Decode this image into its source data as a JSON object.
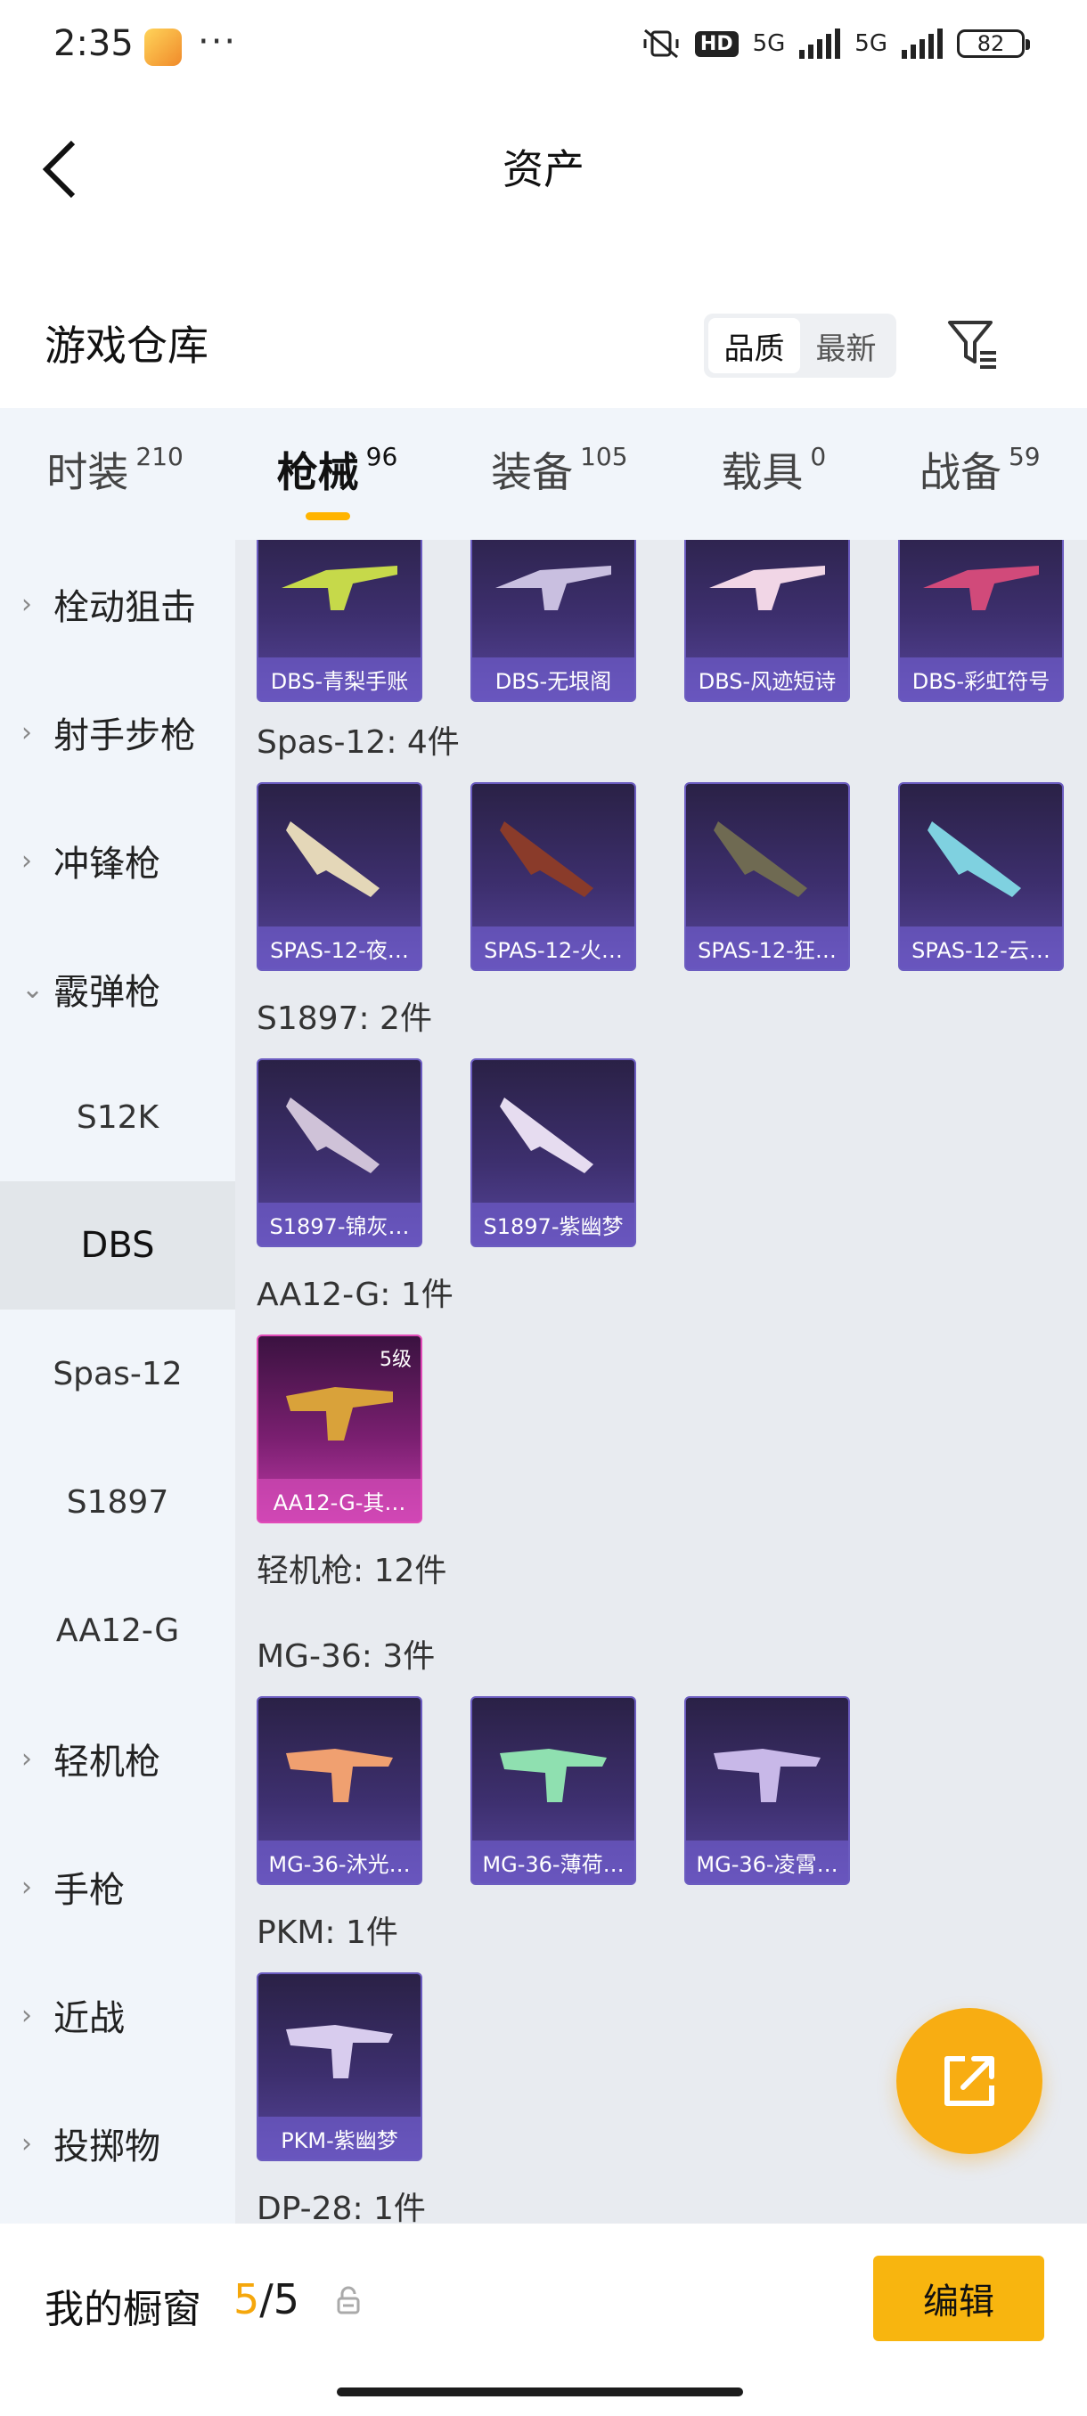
{
  "status": {
    "time": "2:35",
    "more": "···",
    "network": "5G",
    "network2": "5G",
    "hd": "HD",
    "battery": "82"
  },
  "header": {
    "title": "资产"
  },
  "warehouse": {
    "title": "游戏仓库",
    "sort_quality": "品质",
    "sort_newest": "最新"
  },
  "tabs": [
    {
      "label": "时装",
      "count": "210"
    },
    {
      "label": "枪械",
      "count": "96"
    },
    {
      "label": "装备",
      "count": "105"
    },
    {
      "label": "载具",
      "count": "0"
    },
    {
      "label": "战备",
      "count": "59"
    }
  ],
  "sidebar": [
    {
      "label": "栓动狙击",
      "chevron": "›"
    },
    {
      "label": "射手步枪",
      "chevron": "›"
    },
    {
      "label": "冲锋枪",
      "chevron": "›"
    },
    {
      "label": "霰弹枪",
      "chevron": "⌄"
    },
    {
      "label": "S12K"
    },
    {
      "label": "DBS"
    },
    {
      "label": "Spas-12"
    },
    {
      "label": "S1897"
    },
    {
      "label": "AA12-G"
    },
    {
      "label": "轻机枪",
      "chevron": "›"
    },
    {
      "label": "手枪",
      "chevron": "›"
    },
    {
      "label": "近战",
      "chevron": "›"
    },
    {
      "label": "投掷物",
      "chevron": "›"
    }
  ],
  "groups": {
    "dbs": {
      "items": [
        "DBS-青梨手账",
        "DBS-无垠阁",
        "DBS-风迹短诗",
        "DBS-彩虹符号"
      ]
    },
    "spas": {
      "label": "Spas-12: 4件",
      "items": [
        "SPAS-12-夜…",
        "SPAS-12-火…",
        "SPAS-12-狂…",
        "SPAS-12-云…"
      ]
    },
    "s1897": {
      "label": "S1897: 2件",
      "items": [
        "S1897-锦灰…",
        "S1897-紫幽梦"
      ]
    },
    "aa12": {
      "label": "AA12-G: 1件",
      "items": [
        "AA12-G-其…"
      ],
      "level": "5级"
    },
    "lmg": {
      "label": "轻机枪: 12件"
    },
    "mg36": {
      "label": "MG-36: 3件",
      "items": [
        "MG-36-沐光…",
        "MG-36-薄荷…",
        "MG-36-凌霄…"
      ]
    },
    "pkm": {
      "label": "PKM: 1件",
      "items": [
        "PKM-紫幽梦"
      ]
    },
    "dp28": {
      "label": "DP-28: 1件"
    }
  },
  "bottom": {
    "title": "我的橱窗",
    "count_current": "5",
    "count_sep": "/",
    "count_total": "5",
    "edit_label": "编辑"
  },
  "colors": {
    "accent": "#f8b50f",
    "tab_underline": "#ffb400",
    "card_purple": "#3d2f6e",
    "card_gold": "#c03aa8"
  },
  "icons": [
    "back-icon",
    "filter-icon",
    "share-icon",
    "lock-icon",
    "chevron-right-icon",
    "chevron-down-icon"
  ]
}
